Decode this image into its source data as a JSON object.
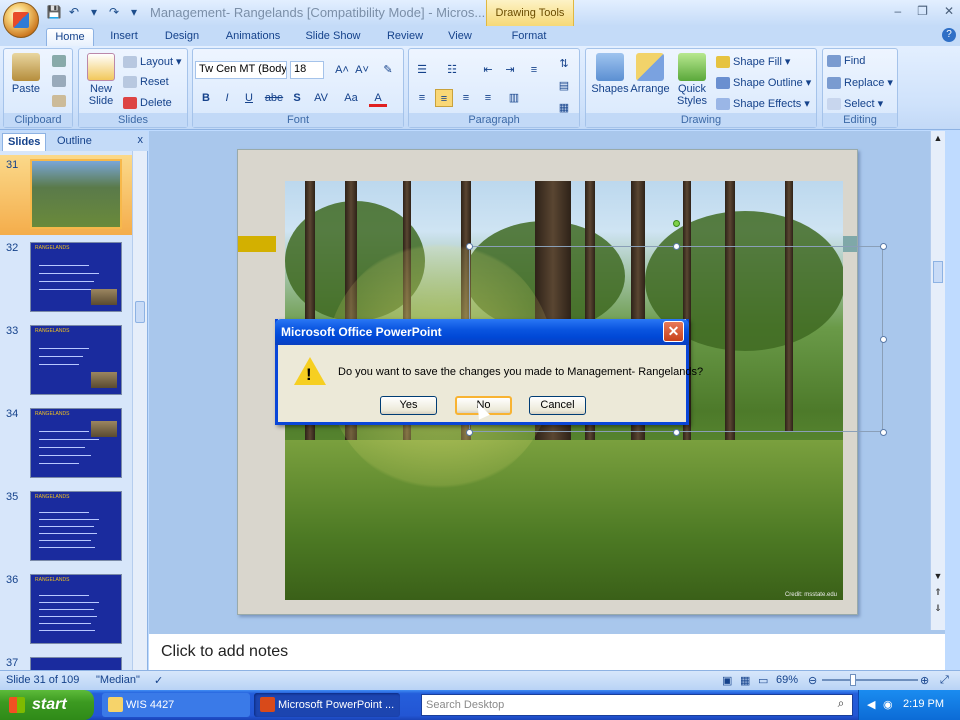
{
  "window": {
    "title": "Management- Rangelands [Compatibility Mode] - Micros...",
    "context_tab": "Drawing Tools",
    "minimize": "–",
    "restore": "❐",
    "close": "✕"
  },
  "tabs": [
    "Home",
    "Insert",
    "Design",
    "Animations",
    "Slide Show",
    "Review",
    "View",
    "Format"
  ],
  "ribbon": {
    "clipboard": {
      "label": "Clipboard",
      "paste": "Paste"
    },
    "slides": {
      "label": "Slides",
      "new_slide": "New Slide",
      "layout": "Layout",
      "reset": "Reset",
      "delete": "Delete"
    },
    "font": {
      "label": "Font",
      "font_name": "Tw Cen MT (Body",
      "font_size": "18",
      "bold": "B",
      "italic": "I",
      "underline": "U",
      "strike": "abe",
      "shadow": "S",
      "spacing": "AV",
      "case": "Aa",
      "color": "A"
    },
    "paragraph": {
      "label": "Paragraph"
    },
    "drawing": {
      "label": "Drawing",
      "shapes": "Shapes",
      "arrange": "Arrange",
      "quick_styles": "Quick Styles",
      "shape_fill": "Shape Fill",
      "shape_outline": "Shape Outline",
      "shape_effects": "Shape Effects"
    },
    "editing": {
      "label": "Editing",
      "find": "Find",
      "replace": "Replace",
      "select": "Select"
    }
  },
  "panel": {
    "tab_slides": "Slides",
    "tab_outline": "Outline",
    "close": "x",
    "thumbnails": [
      {
        "num": "31",
        "title": ""
      },
      {
        "num": "32",
        "title": "RANGELANDS"
      },
      {
        "num": "33",
        "title": "RANGELANDS"
      },
      {
        "num": "34",
        "title": "RANGELANDS"
      },
      {
        "num": "35",
        "title": "RANGELANDS"
      },
      {
        "num": "36",
        "title": "RANGELANDS"
      },
      {
        "num": "37",
        "title": ""
      }
    ]
  },
  "slide": {
    "credit": "Credit: msstate.edu"
  },
  "notes": {
    "placeholder": "Click to add notes"
  },
  "status": {
    "slide_info": "Slide 31 of 109",
    "theme": "\"Median\"",
    "zoom": "69%"
  },
  "dialog": {
    "title": "Microsoft Office PowerPoint",
    "message": "Do you want to save the changes you made to Management- Rangelands?",
    "yes": "Yes",
    "no": "No",
    "cancel": "Cancel"
  },
  "taskbar": {
    "start": "start",
    "task1": "WIS 4427",
    "task2": "Microsoft PowerPoint ...",
    "search_placeholder": "Search Desktop",
    "clock": "2:19 PM"
  }
}
